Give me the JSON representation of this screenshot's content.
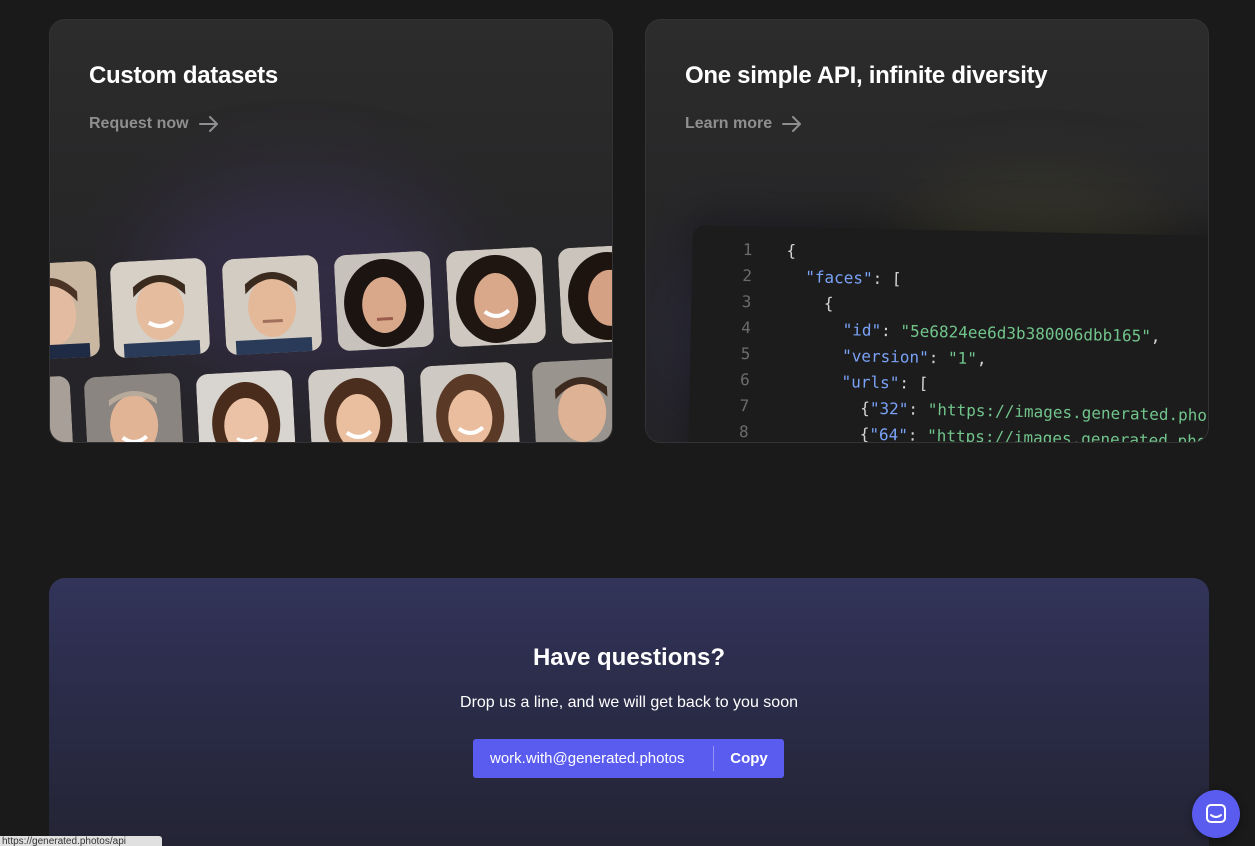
{
  "cards": {
    "left": {
      "title": "Custom datasets",
      "link": "Request now"
    },
    "right": {
      "title": "One simple API, infinite diversity",
      "link": "Learn more"
    }
  },
  "code": {
    "lines": [
      {
        "n": "1",
        "text": "{"
      },
      {
        "n": "2",
        "indent": "  ",
        "key": "\"faces\"",
        "rest": ": ["
      },
      {
        "n": "3",
        "text": "    {"
      },
      {
        "n": "4",
        "indent": "      ",
        "key": "\"id\"",
        "rest": ": ",
        "str": "\"5e6824ee6d3b380006dbb165\"",
        "tail": ","
      },
      {
        "n": "5",
        "indent": "      ",
        "key": "\"version\"",
        "rest": ": ",
        "str": "\"1\"",
        "tail": ","
      },
      {
        "n": "6",
        "indent": "      ",
        "key": "\"urls\"",
        "rest": ": ["
      },
      {
        "n": "7",
        "indent": "        {",
        "key": "\"32\"",
        "rest": ": ",
        "str": "\"https://images.generated.photos/"
      },
      {
        "n": "8",
        "indent": "        {",
        "key": "\"64\"",
        "rest": ": ",
        "str": "\"https://images.generated.photos"
      }
    ]
  },
  "questions": {
    "title": "Have questions?",
    "subtitle": "Drop us a line, and we will get back to you soon",
    "email": "work.with@generated.photos",
    "copy_label": "Copy"
  },
  "status_url": "https://generated.photos/api",
  "colors": {
    "accent": "#5a5cf0",
    "bg": "#1a1a1a",
    "code_key": "#7aa2f7",
    "code_string": "#71c48b"
  }
}
